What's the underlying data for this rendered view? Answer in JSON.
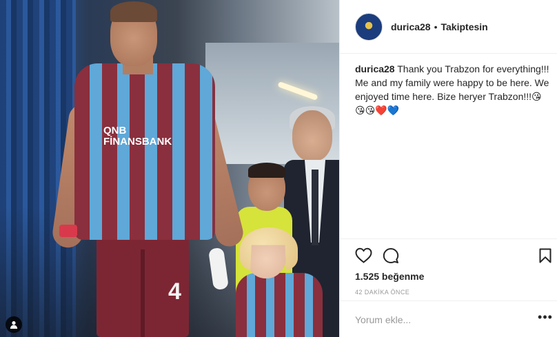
{
  "post": {
    "author": {
      "username": "durica28",
      "separator": "•",
      "follow_status": "Takiptesin"
    },
    "photo": {
      "shorts_number": "4",
      "sponsor_text": "QNB\nFİNANSBANK",
      "user_tag_icon": "person-tag-icon"
    },
    "caption": {
      "username": "durica28",
      "text": "Thank you Trabzon for everything!!! Me and my family were happy to be here. We enjoyed time here. Bize heryer Trabzon!!!😘😘😘❤️💙"
    },
    "actions": {
      "like_icon": "heart-icon",
      "comment_icon": "speech-bubble-icon",
      "save_icon": "bookmark-icon"
    },
    "likes_text": "1.525 beğenme",
    "time_text": "42 DAKİKA ÖNCE",
    "comment_input": {
      "placeholder": "Yorum ekle...",
      "value": ""
    },
    "more_icon": "more-dots-icon"
  },
  "colors": {
    "text": "#262626",
    "muted": "#999999",
    "border": "#efefef"
  }
}
